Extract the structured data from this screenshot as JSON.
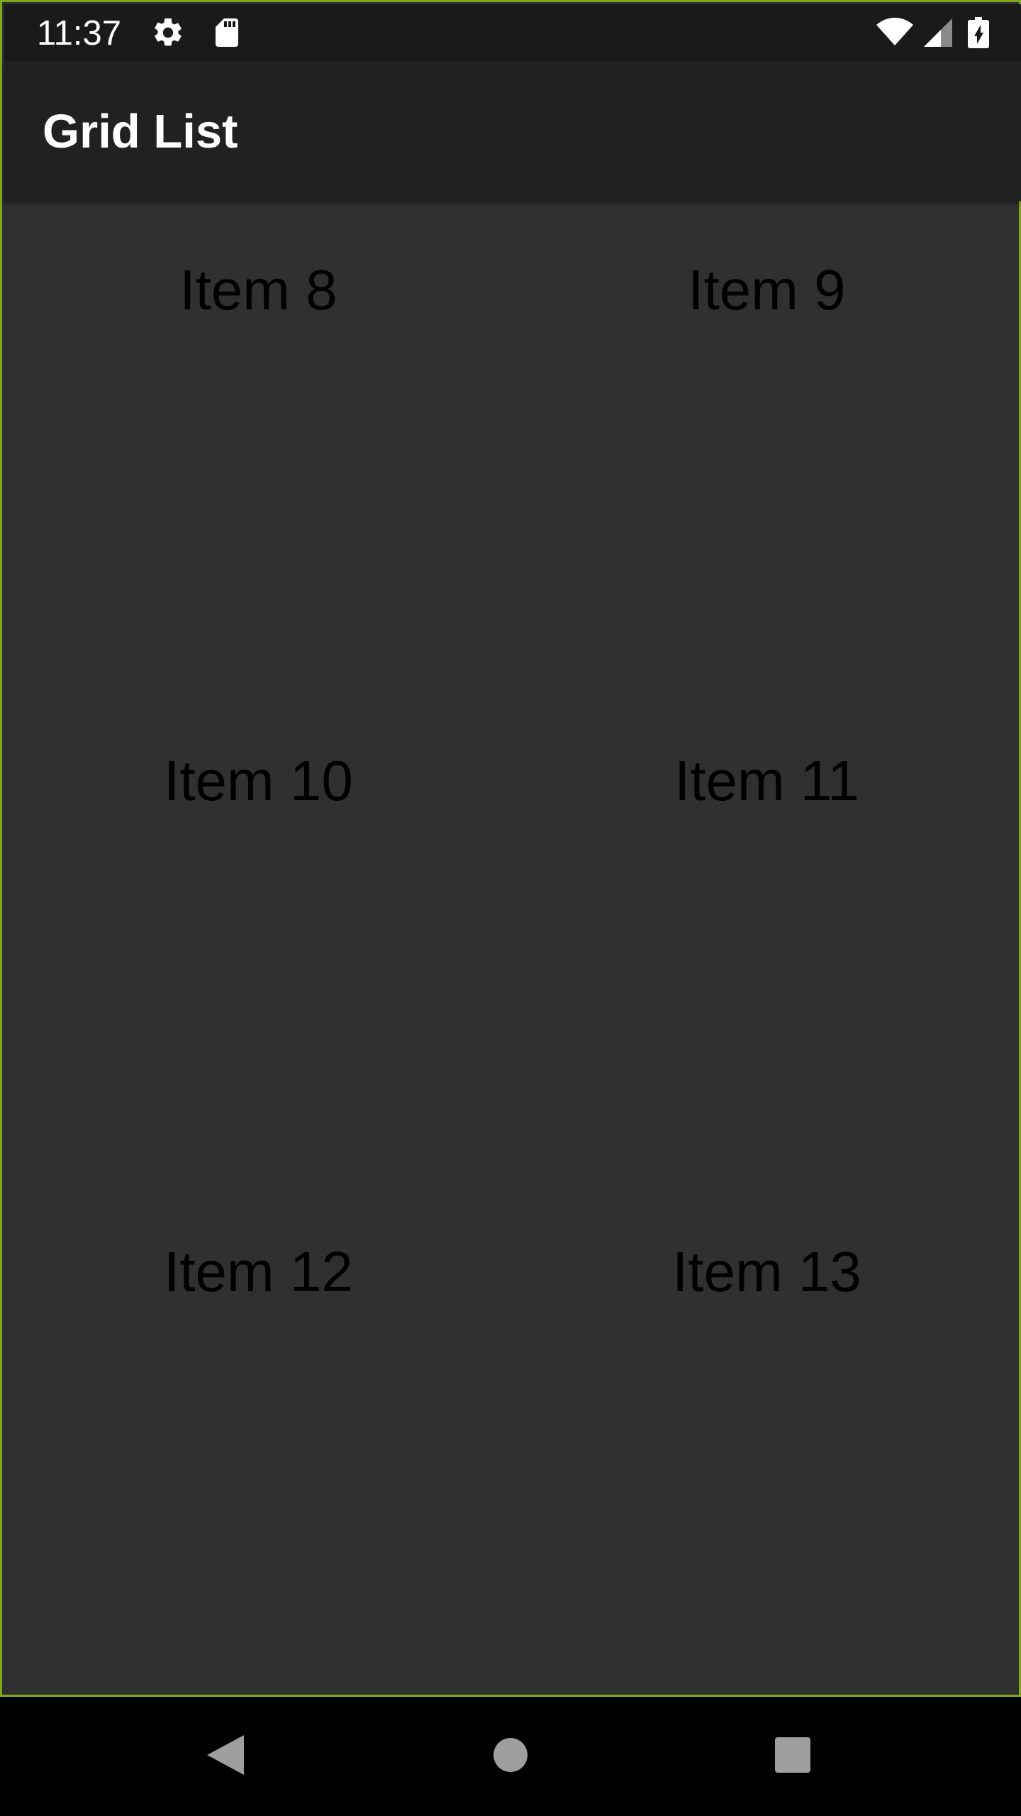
{
  "status_bar": {
    "time": "11:37",
    "icons": [
      "gear-icon",
      "sd-card-icon",
      "wifi-icon",
      "cell-signal-icon",
      "battery-charging-icon"
    ]
  },
  "app_bar": {
    "title": "Grid List"
  },
  "grid": {
    "items": [
      {
        "label": "Item 8"
      },
      {
        "label": "Item 9"
      },
      {
        "label": "Item 10"
      },
      {
        "label": "Item 11"
      },
      {
        "label": "Item 12"
      },
      {
        "label": "Item 13"
      }
    ]
  },
  "nav_bar": {
    "buttons": [
      "back-icon",
      "home-icon",
      "recents-icon"
    ]
  },
  "colors": {
    "frame_outline": "#7fa81a",
    "content_bg": "#303030",
    "app_bar_bg": "#212121",
    "status_bar_bg": "#1a1a1a",
    "item_text": "#000000",
    "title_text": "#ffffff",
    "nav_icon": "#9e9e9e"
  }
}
